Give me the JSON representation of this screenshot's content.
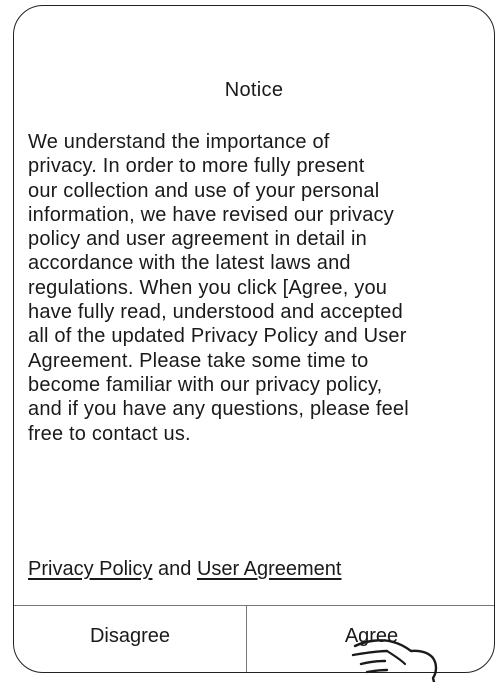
{
  "dialog": {
    "title": "Notice",
    "body": "We understand the importance of\nprivacy. In order to more fully present\nour collection and use of your personal\ninformation, we have revised our privacy\npolicy and user agreement in detail in\naccordance with the latest laws and\nregulations. When you click [Agree, you\nhave fully read, understood and accepted\nall of the updated Privacy Policy and User\nAgreement. Please take some time to\nbecome familiar with our privacy policy,\nand if you have any questions, please feel\nfree to contact us.",
    "privacy_link": "Privacy Policy",
    "and_text": " and ",
    "user_agreement_link": "User Agreement",
    "disagree_label": "Disagree",
    "agree_label": "Agree"
  },
  "icons": {
    "pointer": "pointing-hand-icon"
  }
}
